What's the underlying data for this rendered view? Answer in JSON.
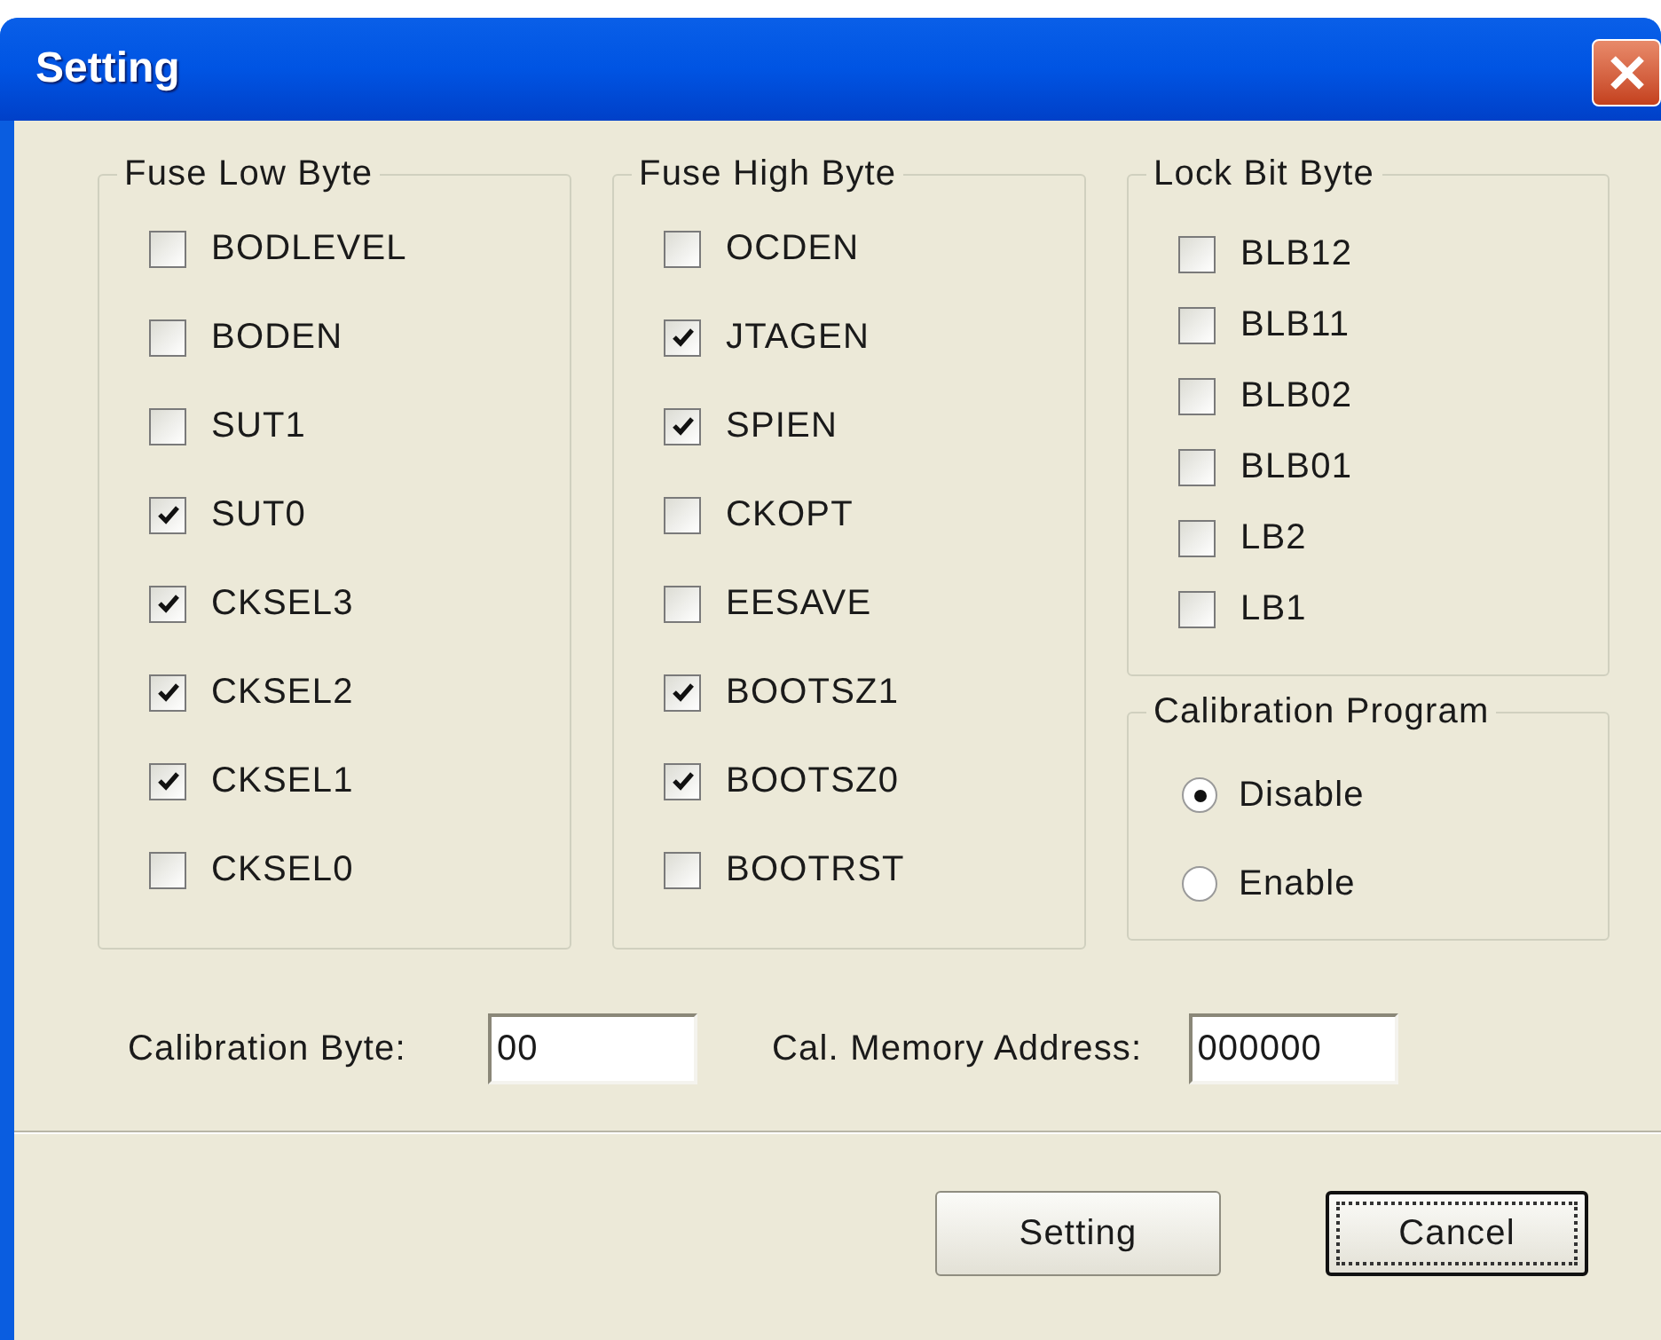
{
  "window": {
    "title": "Setting"
  },
  "groups": [
    {
      "title": "Fuse Low Byte",
      "kind": "wide",
      "items": [
        {
          "label": "BODLEVEL",
          "checked": false
        },
        {
          "label": "BODEN",
          "checked": false
        },
        {
          "label": "SUT1",
          "checked": false
        },
        {
          "label": "SUT0",
          "checked": true
        },
        {
          "label": "CKSEL3",
          "checked": true
        },
        {
          "label": "CKSEL2",
          "checked": true
        },
        {
          "label": "CKSEL1",
          "checked": true
        },
        {
          "label": "CKSEL0",
          "checked": false
        }
      ]
    },
    {
      "title": "Fuse High Byte",
      "kind": "wide",
      "items": [
        {
          "label": "OCDEN",
          "checked": false
        },
        {
          "label": "JTAGEN",
          "checked": true
        },
        {
          "label": "SPIEN",
          "checked": true
        },
        {
          "label": "CKOPT",
          "checked": false
        },
        {
          "label": "EESAVE",
          "checked": false
        },
        {
          "label": "BOOTSZ1",
          "checked": true
        },
        {
          "label": "BOOTSZ0",
          "checked": true
        },
        {
          "label": "BOOTRST",
          "checked": false
        }
      ]
    },
    {
      "title": "Lock Bit Byte",
      "kind": "compact",
      "items": [
        {
          "label": "BLB12",
          "checked": false
        },
        {
          "label": "BLB11",
          "checked": false
        },
        {
          "label": "BLB02",
          "checked": false
        },
        {
          "label": "BLB01",
          "checked": false
        },
        {
          "label": "LB2",
          "checked": false
        },
        {
          "label": "LB1",
          "checked": false
        }
      ]
    }
  ],
  "calibration_program": {
    "title": "Calibration Program",
    "options": [
      {
        "label": "Disable",
        "selected": true
      },
      {
        "label": "Enable",
        "selected": false
      }
    ]
  },
  "fields": [
    {
      "label": "Calibration Byte:",
      "value": "00"
    },
    {
      "label": "Cal. Memory Address:",
      "value": "000000"
    }
  ],
  "buttons": [
    {
      "label": "Setting",
      "focused": false
    },
    {
      "label": "Cancel",
      "focused": true
    }
  ]
}
